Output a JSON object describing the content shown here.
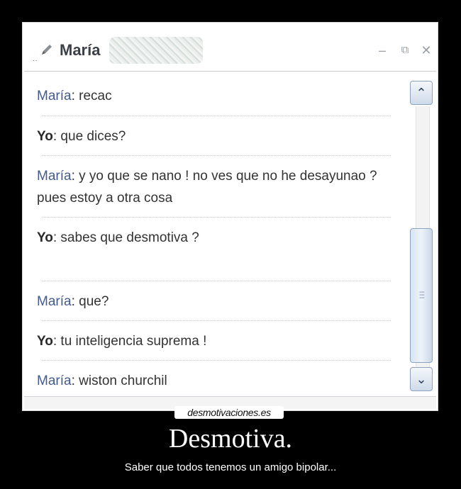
{
  "window": {
    "title_prefix": "..",
    "contact_name": "María",
    "buttons": [
      "–",
      "⧉",
      "✕"
    ]
  },
  "messages": [
    {
      "speaker": "María",
      "text": ": recac"
    },
    {
      "speaker": "Yo",
      "text": ": que dices?"
    },
    {
      "speaker": "María",
      "text": ": y yo que se nano ! no ves que no he desayunao ? pues estoy a otra cosa"
    },
    {
      "speaker": "Yo",
      "text": ": sabes que desmotiva ?"
    },
    {
      "speaker": "María",
      "text": ": que?"
    },
    {
      "speaker": "Yo",
      "text": ": tu inteligencia suprema !"
    },
    {
      "speaker": "María",
      "text": ": wiston churchil"
    }
  ],
  "scrollbar": {
    "up": "⌃",
    "down": "⌄"
  },
  "poster": {
    "site": "desmotivaciones.es",
    "headline": "Desmotiva.",
    "caption": "Saber que todos tenemos un amigo bipolar..."
  },
  "colors": {
    "speaker_maria": "#445a8a",
    "speaker_yo": "#2a2a2a",
    "background": "#000000"
  }
}
